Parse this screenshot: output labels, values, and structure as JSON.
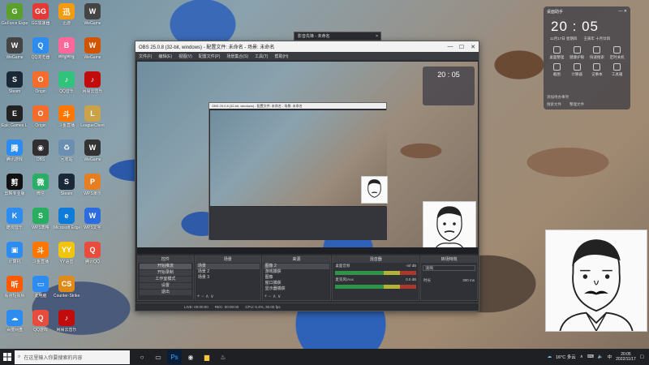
{
  "desktop_icons": [
    {
      "label": "GeForce Experience",
      "color": "#5aa02c",
      "glyph": "G"
    },
    {
      "label": "GG加速器",
      "color": "#e53935",
      "glyph": "GG"
    },
    {
      "label": "迅游",
      "color": "#f39c12",
      "glyph": "迅"
    },
    {
      "label": "WeGame",
      "color": "#444",
      "glyph": "W"
    },
    {
      "label": "WeGame",
      "color": "#444",
      "glyph": "W"
    },
    {
      "label": "QQ浏览器",
      "color": "#2d8cf0",
      "glyph": "Q"
    },
    {
      "label": "哔哩哔哩",
      "color": "#ff6699",
      "glyph": "B"
    },
    {
      "label": "WeGame",
      "color": "#d35400",
      "glyph": "W"
    },
    {
      "label": "Steam",
      "color": "#1b2838",
      "glyph": "S"
    },
    {
      "label": "Origin",
      "color": "#f56c2d",
      "glyph": "O"
    },
    {
      "label": "QQ音乐",
      "color": "#31c27c",
      "glyph": "♪"
    },
    {
      "label": "网易云音乐",
      "color": "#c20c0c",
      "glyph": "♪"
    },
    {
      "label": "Epic Games Launcher",
      "color": "#222",
      "glyph": "E"
    },
    {
      "label": "Origin",
      "color": "#f56c2d",
      "glyph": "O"
    },
    {
      "label": "斗鱼直播",
      "color": "#ff7700",
      "glyph": "斗"
    },
    {
      "label": "LeagueClient",
      "color": "#c9a24a",
      "glyph": "L"
    },
    {
      "label": "腾讯游戏",
      "color": "#2d8cf0",
      "glyph": "腾"
    },
    {
      "label": "OBS",
      "color": "#302e31",
      "glyph": "◉"
    },
    {
      "label": "回收站",
      "color": "#6a8fb3",
      "glyph": "♻"
    },
    {
      "label": "WeGame",
      "color": "#333",
      "glyph": "W"
    },
    {
      "label": "剪映专业版",
      "color": "#111",
      "glyph": "剪"
    },
    {
      "label": "微信",
      "color": "#2aae67",
      "glyph": "微"
    },
    {
      "label": "Steam",
      "color": "#1b2838",
      "glyph": "S"
    },
    {
      "label": "WPS演示",
      "color": "#e67e22",
      "glyph": "P"
    },
    {
      "label": "酷狗音乐",
      "color": "#2d8cf0",
      "glyph": "K"
    },
    {
      "label": "WPS表格",
      "color": "#27ae60",
      "glyph": "S"
    },
    {
      "label": "Microsoft Edge",
      "color": "#0f7bd8",
      "glyph": "e"
    },
    {
      "label": "WPS文字",
      "color": "#2d6cdf",
      "glyph": "W"
    },
    {
      "label": "计算机",
      "color": "#2d8cf0",
      "glyph": "▣"
    },
    {
      "label": "斗鱼直播",
      "color": "#ff7700",
      "glyph": "斗"
    },
    {
      "label": "YY语音",
      "color": "#f1c40f",
      "glyph": "YY"
    },
    {
      "label": "腾讯QQ",
      "color": "#e74c3c",
      "glyph": "Q"
    },
    {
      "label": "看点短视频",
      "color": "#ff5a00",
      "glyph": "听"
    },
    {
      "label": "此电脑",
      "color": "#2d8cf0",
      "glyph": "▭"
    },
    {
      "label": "Counter-Strike Global",
      "color": "#e08a1a",
      "glyph": "CS"
    },
    {
      "label": "",
      "color": "#fff",
      "glyph": ""
    },
    {
      "label": "百度网盘",
      "color": "#2d8cf0",
      "glyph": "☁"
    },
    {
      "label": "QQ游戏",
      "color": "#e74c3c",
      "glyph": "Q"
    },
    {
      "label": "网易云音乐",
      "color": "#c20c0c",
      "glyph": "♪"
    }
  ],
  "obs": {
    "title": "OBS 25.0.8 (32-bit, windows) - 配置文件: 未命名 - 场景: 未命名",
    "menu": [
      "文件(F)",
      "编辑(E)",
      "视图(V)",
      "配置文件(P)",
      "场景集合(S)",
      "工具(T)",
      "帮助(H)"
    ],
    "dock_titles": {
      "controls": "控件",
      "scenes": "场景",
      "sources": "来源",
      "mixer": "混音器",
      "transitions": "转场特效"
    },
    "controls": [
      "开始推流",
      "开始录制",
      "工作室模式",
      "设置",
      "退出"
    ],
    "scenes": [
      "场景",
      "场景 2",
      "场景 3"
    ],
    "sources": [
      "图像 2",
      "游戏捕获",
      "图像",
      "窗口捕获",
      "显示器捕获"
    ],
    "mixer": [
      {
        "name": "桌面音频",
        "db": "-inf dB"
      },
      {
        "name": "麦克风/Aux",
        "db": "0.0 dB"
      }
    ],
    "transition": {
      "name": "淡出",
      "duration_label": "时长",
      "duration": "300 ms"
    },
    "status": [
      "LIVE: 00:00:00",
      "REC: 00:00:00",
      "CPU: 6.4%, 30.00 fps"
    ],
    "dock_footer": "+ − ∧ ∨"
  },
  "popup": {
    "title": "影音先锋 - 未命名",
    "close": "×"
  },
  "widget": {
    "title": "桌面助手",
    "time": "20 : 05",
    "date": "11月17日 星期四",
    "lunar": "壬寅年 十月廿四",
    "items": [
      "桌面整理",
      "健康护眼",
      "快速搜索",
      "定时关机",
      "截图",
      "计算器",
      "记事本",
      "工具箱"
    ],
    "todo": "添加待办事项",
    "footer": [
      "搜索文件",
      "整理文件"
    ]
  },
  "taskbar": {
    "search_placeholder": "在这里输入你要搜索的内容",
    "weather": "16°C 多云",
    "time": "20:05",
    "date": "2022/11/17",
    "lang": "中"
  },
  "colors": {
    "taskbar": "#1f2023",
    "obs_bg": "#2b2d31"
  }
}
